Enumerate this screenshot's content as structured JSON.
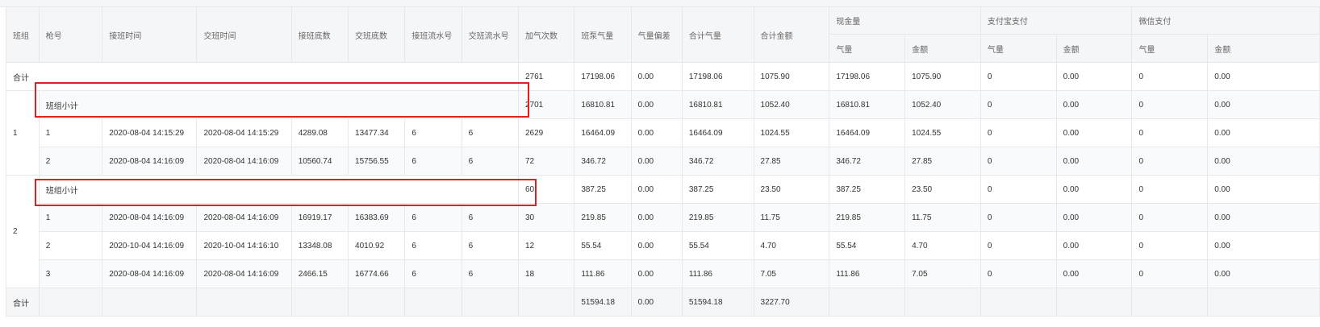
{
  "headers": {
    "banzu": "班组",
    "qianghao": "枪号",
    "jieban_time": "接班时间",
    "jiaoban_time": "交班时间",
    "jieban_dishu": "接班底数",
    "jiaoban_dishu": "交班底数",
    "jieban_liushui": "接班流水号",
    "jiaoban_liushui": "交班流水号",
    "jiaqi_cishu": "加气次数",
    "banbeng_qiliang": "班泵气量",
    "qiliang_piancha": "气量偏差",
    "heji_qiliang": "合计气量",
    "heji_jine": "合计金额",
    "xianjin": "现金量",
    "zhifubao": "支付宝支付",
    "weixin": "微信支付",
    "sub_qiliang": "气量",
    "sub_jine": "金额"
  },
  "rows": {
    "total_top": {
      "label": "合计",
      "jiaqi": "2761",
      "banbeng": "17198.06",
      "piancha": "0.00",
      "heji_qiliang": "17198.06",
      "heji_jine": "1075.90",
      "xj_ql": "17198.06",
      "xj_je": "1075.90",
      "zfb_ql": "0",
      "zfb_je": "0.00",
      "wx_ql": "0",
      "wx_je": "0.00"
    },
    "g1_sub": {
      "label": "班组小计",
      "jiaqi": "2701",
      "banbeng": "16810.81",
      "piancha": "0.00",
      "heji_qiliang": "16810.81",
      "heji_jine": "1052.40",
      "xj_ql": "16810.81",
      "xj_je": "1052.40",
      "zfb_ql": "0",
      "zfb_je": "0.00",
      "wx_ql": "0",
      "wx_je": "0.00"
    },
    "g1_r1": {
      "group": "1",
      "qiang": "1",
      "jieban_time": "2020-08-04 14:15:29",
      "jiaoban_time": "2020-08-04 14:15:29",
      "jieban_dishu": "4289.08",
      "jiaoban_dishu": "13477.34",
      "jieban_liushui": "6",
      "jiaoban_liushui": "6",
      "jiaqi": "2629",
      "banbeng": "16464.09",
      "piancha": "0.00",
      "heji_qiliang": "16464.09",
      "heji_jine": "1024.55",
      "xj_ql": "16464.09",
      "xj_je": "1024.55",
      "zfb_ql": "0",
      "zfb_je": "0.00",
      "wx_ql": "0",
      "wx_je": "0.00"
    },
    "g1_r2": {
      "qiang": "2",
      "jieban_time": "2020-08-04 14:16:09",
      "jiaoban_time": "2020-08-04 14:16:09",
      "jieban_dishu": "10560.74",
      "jiaoban_dishu": "15756.55",
      "jieban_liushui": "6",
      "jiaoban_liushui": "6",
      "jiaqi": "72",
      "banbeng": "346.72",
      "piancha": "0.00",
      "heji_qiliang": "346.72",
      "heji_jine": "27.85",
      "xj_ql": "346.72",
      "xj_je": "27.85",
      "zfb_ql": "0",
      "zfb_je": "0.00",
      "wx_ql": "0",
      "wx_je": "0.00"
    },
    "g2_sub": {
      "label": "班组小计",
      "jiaqi": "60",
      "banbeng": "387.25",
      "piancha": "0.00",
      "heji_qiliang": "387.25",
      "heji_jine": "23.50",
      "xj_ql": "387.25",
      "xj_je": "23.50",
      "zfb_ql": "0",
      "zfb_je": "0.00",
      "wx_ql": "0",
      "wx_je": "0.00"
    },
    "g2_r1": {
      "group": "2",
      "qiang": "1",
      "jieban_time": "2020-08-04 14:16:09",
      "jiaoban_time": "2020-08-04 14:16:09",
      "jieban_dishu": "16919.17",
      "jiaoban_dishu": "16383.69",
      "jieban_liushui": "6",
      "jiaoban_liushui": "6",
      "jiaqi": "30",
      "banbeng": "219.85",
      "piancha": "0.00",
      "heji_qiliang": "219.85",
      "heji_jine": "11.75",
      "xj_ql": "219.85",
      "xj_je": "11.75",
      "zfb_ql": "0",
      "zfb_je": "0.00",
      "wx_ql": "0",
      "wx_je": "0.00"
    },
    "g2_r2": {
      "qiang": "2",
      "jieban_time": "2020-10-04 14:16:09",
      "jiaoban_time": "2020-10-04 14:16:10",
      "jieban_dishu": "13348.08",
      "jiaoban_dishu": "4010.92",
      "jieban_liushui": "6",
      "jiaoban_liushui": "6",
      "jiaqi": "12",
      "banbeng": "55.54",
      "piancha": "0.00",
      "heji_qiliang": "55.54",
      "heji_jine": "4.70",
      "xj_ql": "55.54",
      "xj_je": "4.70",
      "zfb_ql": "0",
      "zfb_je": "0.00",
      "wx_ql": "0",
      "wx_je": "0.00"
    },
    "g2_r3": {
      "qiang": "3",
      "jieban_time": "2020-08-04 14:16:09",
      "jiaoban_time": "2020-08-04 14:16:09",
      "jieban_dishu": "2466.15",
      "jiaoban_dishu": "16774.66",
      "jieban_liushui": "6",
      "jiaoban_liushui": "6",
      "jiaqi": "18",
      "banbeng": "111.86",
      "piancha": "0.00",
      "heji_qiliang": "111.86",
      "heji_jine": "7.05",
      "xj_ql": "111.86",
      "xj_je": "7.05",
      "zfb_ql": "0",
      "zfb_je": "0.00",
      "wx_ql": "0",
      "wx_je": "0.00"
    },
    "total_bottom": {
      "label": "合计",
      "banbeng": "51594.18",
      "piancha": "0.00",
      "heji_qiliang": "51594.18",
      "heji_jine": "3227.70"
    }
  },
  "colors": {
    "header_bg": "#f5f6f8",
    "border": "#e6e8eb",
    "highlight_border": "#e02020",
    "text": "#333333"
  }
}
